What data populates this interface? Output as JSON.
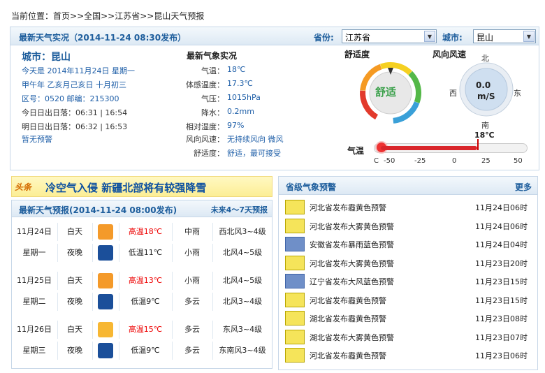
{
  "breadcrumb": {
    "prefix": "当前位置：",
    "path": "首页>>全国>>江苏省>>昆山天气预报"
  },
  "top": {
    "title": "最新天气实况（2014-11-24 08:30发布）",
    "province_label": "省份:",
    "province_value": "江苏省",
    "city_label": "城市:",
    "city_value": "昆山"
  },
  "info": {
    "city": "城市：昆山",
    "lines": [
      "今天是 2014年11月24日 星期一",
      "甲午年 乙亥月己亥日 十月初三",
      "区号：0520  邮编：215300",
      "今日日出日落：06:31 | 16:54",
      "明日日出日落：06:32 | 16:53",
      "暂无预警"
    ]
  },
  "obs": {
    "title": "最新气象实况",
    "rows": [
      {
        "k": "气温：",
        "v": "18℃"
      },
      {
        "k": "体感温度：",
        "v": "17.3℃"
      },
      {
        "k": "气压：",
        "v": "1015hPa"
      },
      {
        "k": "降水：",
        "v": "0.2mm"
      },
      {
        "k": "相对湿度：",
        "v": "97%"
      },
      {
        "k": "风向风速：",
        "v": "无持续风向 微风"
      },
      {
        "k": "舒适度：",
        "v": "舒适，最可接受"
      }
    ]
  },
  "comfort": {
    "label": "舒适度",
    "value": "舒适"
  },
  "wind": {
    "label": "风向风速",
    "speed": "0.0",
    "unit": "m/S",
    "n": "北",
    "s": "南",
    "e": "东",
    "w": "西"
  },
  "temp": {
    "label": "气温",
    "value": "18℃",
    "value_num": 18,
    "unit": "C",
    "ticks": [
      "-50",
      "-25",
      "0",
      "25",
      "50"
    ]
  },
  "news": {
    "tag": "头条",
    "text": "冷空气入侵 新疆北部将有较强降雪"
  },
  "forecast": {
    "title": "最新天气预报(2014-11-24 08:00发布)",
    "more": "未来4～7天预报",
    "days": [
      {
        "date": "11月24日",
        "week": "星期一",
        "day": {
          "period": "白天",
          "icon": "rain-icon",
          "temp": "高温18℃",
          "weather": "中雨",
          "wind": "西北风3~4级"
        },
        "night": {
          "period": "夜晚",
          "icon": "night-rain-icon",
          "temp": "低温11℃",
          "weather": "小雨",
          "wind": "北风4~5级"
        }
      },
      {
        "date": "11月25日",
        "week": "星期二",
        "day": {
          "period": "白天",
          "icon": "rain-icon",
          "temp": "高温13℃",
          "weather": "小雨",
          "wind": "北风4~5级"
        },
        "night": {
          "period": "夜晚",
          "icon": "moon-cloud-icon",
          "temp": "低温9℃",
          "weather": "多云",
          "wind": "北风3~4级"
        }
      },
      {
        "date": "11月26日",
        "week": "星期三",
        "day": {
          "period": "白天",
          "icon": "sun-cloud-icon",
          "temp": "高温15℃",
          "weather": "多云",
          "wind": "东风3~4级"
        },
        "night": {
          "period": "夜晚",
          "icon": "moon-cloud-icon",
          "temp": "低温9℃",
          "weather": "多云",
          "wind": "东南风3~4级"
        }
      }
    ]
  },
  "warnings": {
    "title": "省级气象预警",
    "more": "更多",
    "items": [
      {
        "icon": "haze-yellow-icon",
        "text": "河北省发布霾黄色预警",
        "date": "11月24日06时"
      },
      {
        "icon": "fog-yellow-icon",
        "text": "河北省发布大雾黄色预警",
        "date": "11月24日06时"
      },
      {
        "icon": "rainstorm-blue-icon",
        "text": "安徽省发布暴雨蓝色预警",
        "date": "11月24日04时"
      },
      {
        "icon": "fog-yellow-icon",
        "text": "河北省发布大雾黄色预警",
        "date": "11月23日20时"
      },
      {
        "icon": "gale-blue-icon",
        "text": "辽宁省发布大风蓝色预警",
        "date": "11月23日15时"
      },
      {
        "icon": "haze-yellow-icon",
        "text": "河北省发布霾黄色预警",
        "date": "11月23日15时"
      },
      {
        "icon": "haze-yellow-icon",
        "text": "湖北省发布霾黄色预警",
        "date": "11月23日08时"
      },
      {
        "icon": "fog-yellow-icon",
        "text": "湖北省发布大雾黄色预警",
        "date": "11月23日07时"
      },
      {
        "icon": "haze-yellow-icon",
        "text": "河北省发布霾黄色预警",
        "date": "11月23日06时"
      }
    ]
  },
  "colors": {
    "accent": "#1d5d9c",
    "link": "#1f5fa8",
    "high_temp": "#ee0000",
    "warn_yellow": "#f5e45a",
    "warn_blue": "#6f8fc8"
  }
}
